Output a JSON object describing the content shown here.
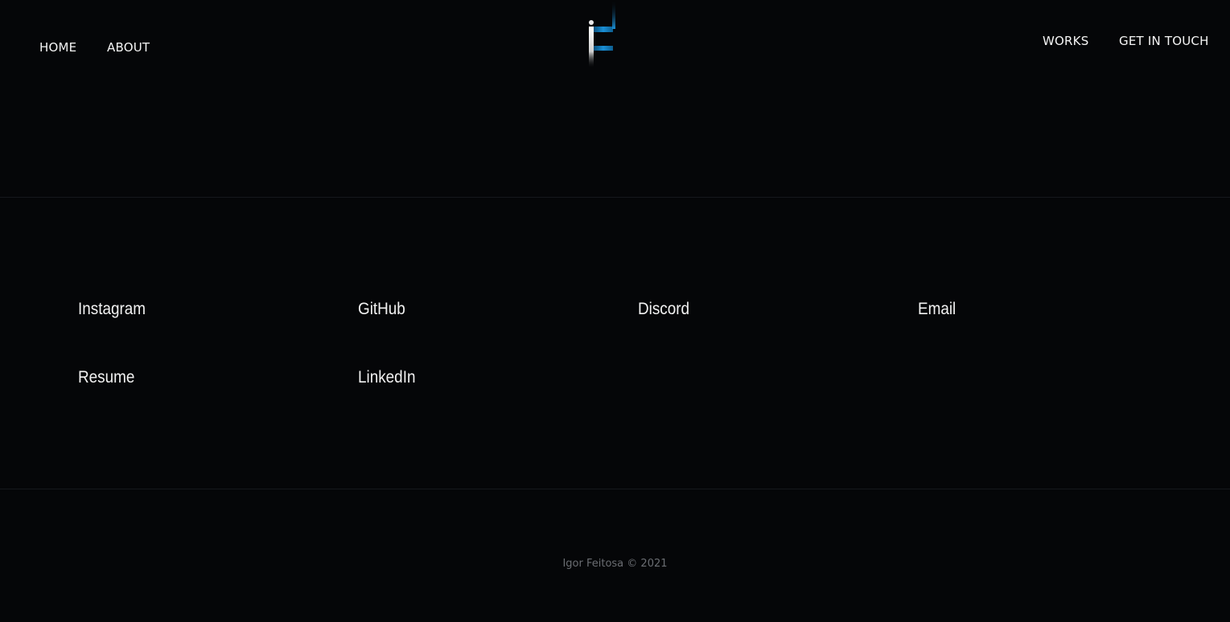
{
  "header": {
    "nav_left": [
      "HOME",
      "ABOUT"
    ],
    "nav_right": [
      "WORKS",
      "GET IN TOUCH"
    ],
    "logo_icon": "if-monogram-logo-icon",
    "colors": {
      "background": "#050608",
      "accent": "#1a8fd6"
    }
  },
  "social": {
    "links": [
      "Instagram",
      "GitHub",
      "Discord",
      "Email",
      "Resume",
      "LinkedIn"
    ]
  },
  "footer": {
    "copyright": "Igor Feitosa © 2021"
  }
}
